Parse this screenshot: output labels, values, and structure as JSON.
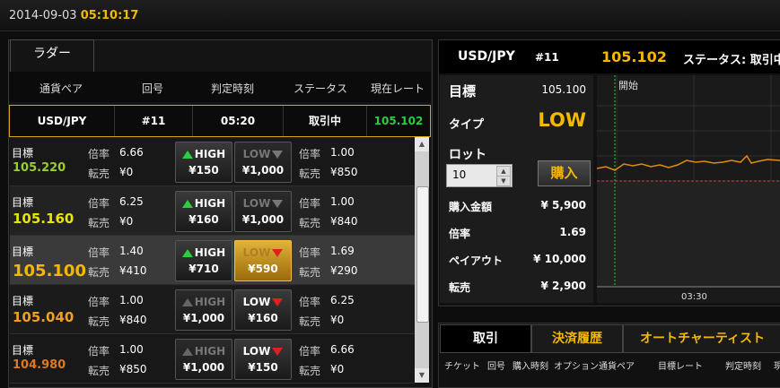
{
  "header": {
    "date": "2014-09-03",
    "time": "05:10:17"
  },
  "ladder": {
    "tab_label": "ラダー",
    "columns": [
      "通貨ペア",
      "回号",
      "判定時刻",
      "ステータス",
      "現在レート"
    ],
    "selected": {
      "pair": "USD/JPY",
      "round": "#11",
      "time": "05:20",
      "status": "取引中",
      "rate": "105.102"
    },
    "rows": [
      {
        "label": "目標",
        "target": "105.220",
        "rate_label": "倍率",
        "high_rate": "6.66",
        "resale_label": "転売",
        "high_resale": "¥0",
        "high_btn": "HIGH",
        "high_price": "¥150",
        "low_btn": "LOW",
        "low_price": "¥1,000",
        "low_rate": "1.00",
        "low_resale": "¥850",
        "target_color": "#9acd32"
      },
      {
        "label": "目標",
        "target": "105.160",
        "rate_label": "倍率",
        "high_rate": "6.25",
        "resale_label": "転売",
        "high_resale": "¥0",
        "high_btn": "HIGH",
        "high_price": "¥160",
        "low_btn": "LOW",
        "low_price": "¥1,000",
        "low_rate": "1.00",
        "low_resale": "¥840",
        "target_color": "#e6e600"
      },
      {
        "label": "目標",
        "target": "105.100",
        "rate_label": "倍率",
        "high_rate": "1.40",
        "resale_label": "転売",
        "high_resale": "¥410",
        "high_btn": "HIGH",
        "high_price": "¥710",
        "low_btn": "LOW",
        "low_price": "¥590",
        "low_rate": "1.69",
        "low_resale": "¥290",
        "target_color": "#f5b800"
      },
      {
        "label": "目標",
        "target": "105.040",
        "rate_label": "倍率",
        "high_rate": "1.00",
        "resale_label": "転売",
        "high_resale": "¥840",
        "high_btn": "HIGH",
        "high_price": "¥1,000",
        "low_btn": "LOW",
        "low_price": "¥160",
        "low_rate": "6.25",
        "low_resale": "¥0",
        "target_color": "#f0a020"
      },
      {
        "label": "目標",
        "target": "104.980",
        "rate_label": "倍率",
        "high_rate": "1.00",
        "resale_label": "転売",
        "high_resale": "¥850",
        "high_btn": "HIGH",
        "high_price": "¥1,000",
        "low_btn": "LOW",
        "low_price": "¥150",
        "low_rate": "6.66",
        "low_resale": "¥0",
        "target_color": "#e07820"
      }
    ]
  },
  "trade": {
    "pair": "USD/JPY",
    "round": "#11",
    "rate": "105.102",
    "status_label": "ステータス: 取引中",
    "target_label": "目標",
    "target_value": "105.100",
    "type_label": "タイプ",
    "type_value": "LOW",
    "lot_label": "ロット",
    "lot_value": "10",
    "buy_label": "購入",
    "amount_label": "購入金額",
    "amount_value": "¥ 5,900",
    "mult_label": "倍率",
    "mult_value": "1.69",
    "payout_label": "ペイアウト",
    "payout_value": "¥ 10,000",
    "resale_label": "転売",
    "resale_value": "¥ 2,900",
    "chart_start_label": "開始",
    "chart_time_label": "03:30"
  },
  "bottom": {
    "tabs": [
      "取引",
      "決済履歴",
      "オートチャーティスト"
    ],
    "columns": [
      "チケット",
      "回号",
      "購入時刻",
      "オプション",
      "通貨ペア",
      "目標レート",
      "判定時刻",
      "現"
    ]
  },
  "colors": {
    "accent": "#f5b800",
    "rate_green": "#2ecc40",
    "high_arrow": "#2ecc40",
    "low_arrow": "#e02020"
  }
}
